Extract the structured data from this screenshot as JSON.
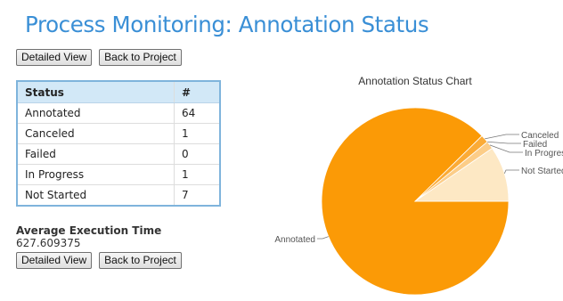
{
  "header": {
    "title": "Process Monitoring: Annotation Status"
  },
  "actions_top": {
    "detailed_view": "Detailed View",
    "back_to_project": "Back to Project"
  },
  "table": {
    "headers": [
      "Status",
      "#"
    ],
    "rows": [
      {
        "status": "Annotated",
        "count": "64"
      },
      {
        "status": "Canceled",
        "count": "1"
      },
      {
        "status": "Failed",
        "count": "0"
      },
      {
        "status": "In Progress",
        "count": "1"
      },
      {
        "status": "Not Started",
        "count": "7"
      }
    ]
  },
  "average_execution": {
    "label": "Average Execution Time",
    "value": "627.609375"
  },
  "actions_bottom": {
    "detailed_view": "Detailed View",
    "back_to_project": "Back to Project"
  },
  "chart_data": {
    "type": "pie",
    "title": "Annotation Status Chart",
    "labels": [
      "Annotated",
      "Canceled",
      "Failed",
      "In Progress",
      "Not Started"
    ],
    "values": [
      64,
      1,
      0,
      1,
      7
    ],
    "colors": [
      "#fb9a06",
      "#fbab36",
      "#fbbc5f",
      "#fccd88",
      "#fde8c4"
    ],
    "start_angle_deg": 0,
    "legend": "leader-line labels"
  }
}
